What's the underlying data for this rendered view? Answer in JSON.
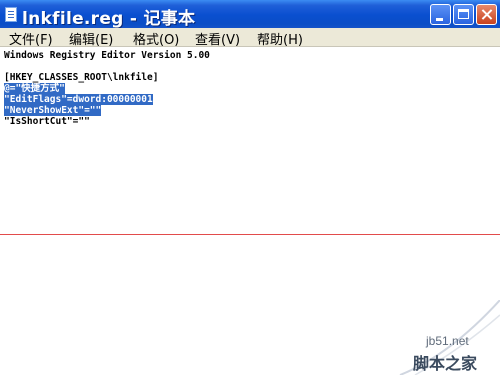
{
  "window": {
    "title": "lnkfile.reg - 记事本",
    "buttons": {
      "minimize": "minimize",
      "maximize": "maximize",
      "close": "close"
    }
  },
  "menu": [
    {
      "label": "文件(F)"
    },
    {
      "label": "编辑(E)"
    },
    {
      "label": "格式(O)"
    },
    {
      "label": "查看(V)"
    },
    {
      "label": "帮助(H)"
    }
  ],
  "document": {
    "lines": [
      {
        "text": "Windows Registry Editor Version 5.00",
        "selected": false
      },
      {
        "text": "",
        "selected": false
      },
      {
        "text": "[HKEY_CLASSES_ROOT\\lnkfile]",
        "selected": false
      },
      {
        "text": "@=\"快捷方式\"",
        "selected": true
      },
      {
        "text": "\"EditFlags\"=dword:00000001",
        "selected": true
      },
      {
        "text": "\"NeverShowExt\"=\"\"",
        "selected": true
      },
      {
        "text": "\"IsShortCut\"=\"\"",
        "selected": false
      }
    ]
  },
  "watermark": {
    "site": "jb51.net",
    "name": "脚本之家"
  },
  "colors": {
    "titlebar": "#0a4fd0",
    "selection": "#316ac5",
    "menubar": "#ece9d8",
    "guide_line": "#e24b4b"
  }
}
